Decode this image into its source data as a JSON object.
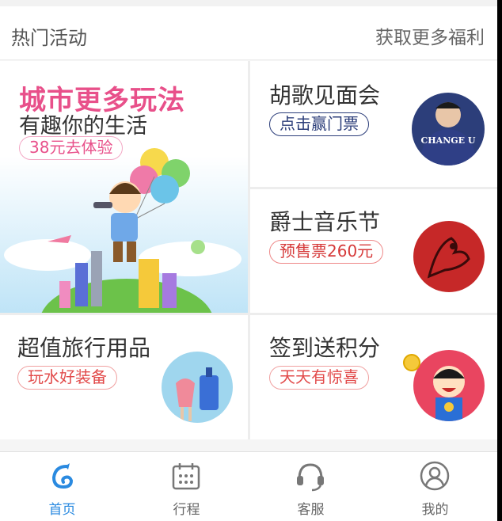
{
  "header": {
    "title": "热门活动",
    "more": "获取更多福利"
  },
  "banner": {
    "headline": "城市更多玩法",
    "subline": "有趣你的生活",
    "pill": "38元去体验"
  },
  "cards": [
    {
      "title": "胡歌见面会",
      "pill": "点击赢门票",
      "avatar_text": "CHANGE U"
    },
    {
      "title": "爵士音乐节",
      "pill": "预售票260元"
    },
    {
      "title": "超值旅行用品",
      "pill": "玩水好装备"
    },
    {
      "title": "签到送积分",
      "pill": "天天有惊喜"
    }
  ],
  "tabs": [
    {
      "label": "首页",
      "icon": "home-icon",
      "active": true
    },
    {
      "label": "行程",
      "icon": "calendar-icon",
      "active": false
    },
    {
      "label": "客服",
      "icon": "headset-icon",
      "active": false
    },
    {
      "label": "我的",
      "icon": "user-icon",
      "active": false
    }
  ],
  "colors": {
    "accent": "#2a8ae0",
    "pink": "#e8508a",
    "navy": "#2c3e7a",
    "red": "#d63a3a"
  }
}
